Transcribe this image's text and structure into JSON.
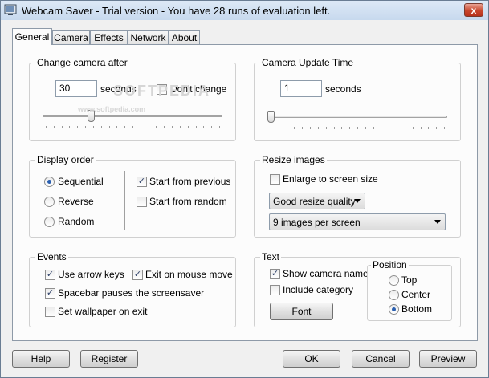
{
  "window": {
    "title": "Webcam Saver - Trial version - You have 28 runs of evaluation left.",
    "close_glyph": "x"
  },
  "tabs": [
    {
      "label": "General",
      "active": true
    },
    {
      "label": "Camera",
      "active": false
    },
    {
      "label": "Effects",
      "active": false
    },
    {
      "label": "Network",
      "active": false
    },
    {
      "label": "About",
      "active": false
    }
  ],
  "change_camera": {
    "title": "Change camera after",
    "value": "30",
    "unit": "seconds",
    "dont_change_label": "Don't change",
    "dont_change_checked": false,
    "slider_fraction": 0.26
  },
  "camera_update": {
    "title": "Camera Update Time",
    "value": "1",
    "unit": "seconds",
    "slider_fraction": 0.0
  },
  "watermark": {
    "main": "SOFTPEDIA",
    "sub": "www.softpedia.com"
  },
  "display_order": {
    "title": "Display order",
    "options": [
      "Sequential",
      "Reverse",
      "Random"
    ],
    "selected": "Sequential",
    "start_from_previous_label": "Start from previous",
    "start_from_previous_checked": true,
    "start_from_random_label": "Start from random",
    "start_from_random_checked": false
  },
  "resize_images": {
    "title": "Resize images",
    "enlarge_label": "Enlarge to screen size",
    "enlarge_checked": false,
    "quality_value": "Good resize quality",
    "per_screen_value": "9 images per screen"
  },
  "events": {
    "title": "Events",
    "use_arrow_keys_label": "Use arrow keys",
    "use_arrow_keys_checked": true,
    "exit_on_mouse_move_label": "Exit on mouse move",
    "exit_on_mouse_move_checked": true,
    "spacebar_label": "Spacebar pauses the screensaver",
    "spacebar_checked": true,
    "wallpaper_label": "Set wallpaper on exit",
    "wallpaper_checked": false
  },
  "text_group": {
    "title": "Text",
    "show_camera_name_label": "Show camera name",
    "show_camera_name_checked": true,
    "include_category_label": "Include category",
    "include_category_checked": false,
    "font_button": "Font",
    "position": {
      "title": "Position",
      "options": [
        "Top",
        "Center",
        "Bottom"
      ],
      "selected": "Bottom"
    }
  },
  "buttons": {
    "help": "Help",
    "register": "Register",
    "ok": "OK",
    "cancel": "Cancel",
    "preview": "Preview"
  },
  "check_glyph": "✓"
}
